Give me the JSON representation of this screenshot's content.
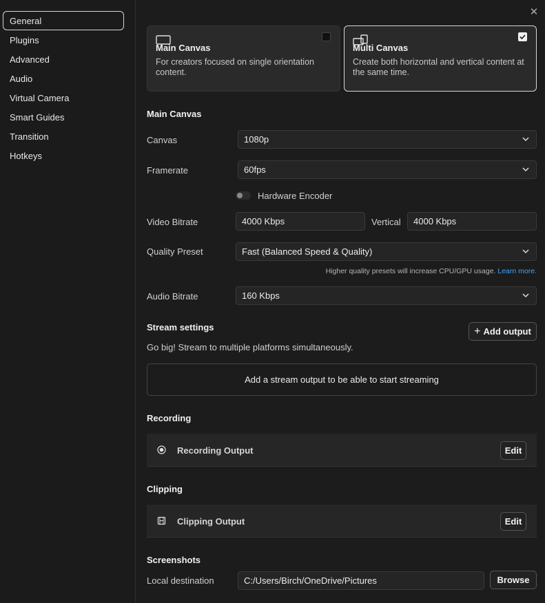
{
  "sidebar": {
    "items": [
      {
        "label": "General"
      },
      {
        "label": "Plugins"
      },
      {
        "label": "Advanced"
      },
      {
        "label": "Audio"
      },
      {
        "label": "Virtual Camera"
      },
      {
        "label": "Smart Guides"
      },
      {
        "label": "Transition"
      },
      {
        "label": "Hotkeys"
      }
    ],
    "active": "General"
  },
  "close_icon": "close-icon",
  "modes": {
    "main": {
      "title": "Main Canvas",
      "desc": "For creators focused on single orientation content.",
      "checked": false
    },
    "multi": {
      "title": "Multi Canvas",
      "desc": "Create both horizontal and vertical content at the same time.",
      "checked": true
    }
  },
  "main_canvas": {
    "section_title": "Main Canvas",
    "canvas_label": "Canvas",
    "canvas_value": "1080p",
    "framerate_label": "Framerate",
    "framerate_value": "60fps",
    "hardware_encoder_label": "Hardware Encoder",
    "hardware_encoder_on": false,
    "video_bitrate_label": "Video Bitrate",
    "video_bitrate_value": "4000 Kbps",
    "vertical_label": "Vertical",
    "vertical_value": "4000 Kbps",
    "quality_label": "Quality Preset",
    "quality_value": "Fast (Balanced Speed & Quality)",
    "quality_hint": "Higher quality presets will increase CPU/GPU usage.",
    "learn_more": "Learn more.",
    "audio_bitrate_label": "Audio Bitrate",
    "audio_bitrate_value": "160 Kbps"
  },
  "stream": {
    "section_title": "Stream settings",
    "subtitle": "Go big! Stream to multiple platforms simultaneously.",
    "add_output": "Add output",
    "empty_text": "Add a stream output to be able to start streaming"
  },
  "recording": {
    "section_title": "Recording",
    "output_label": "Recording Output",
    "edit": "Edit"
  },
  "clipping": {
    "section_title": "Clipping",
    "output_label": "Clipping Output",
    "edit": "Edit"
  },
  "screenshots": {
    "section_title": "Screenshots",
    "destination_label": "Local destination",
    "destination_value": "C:/Users/Birch/OneDrive/Pictures",
    "browse": "Browse"
  },
  "colors": {
    "accent_link": "#3ea6ff",
    "background": "#1c1c1c",
    "card": "#2a2a2a"
  }
}
